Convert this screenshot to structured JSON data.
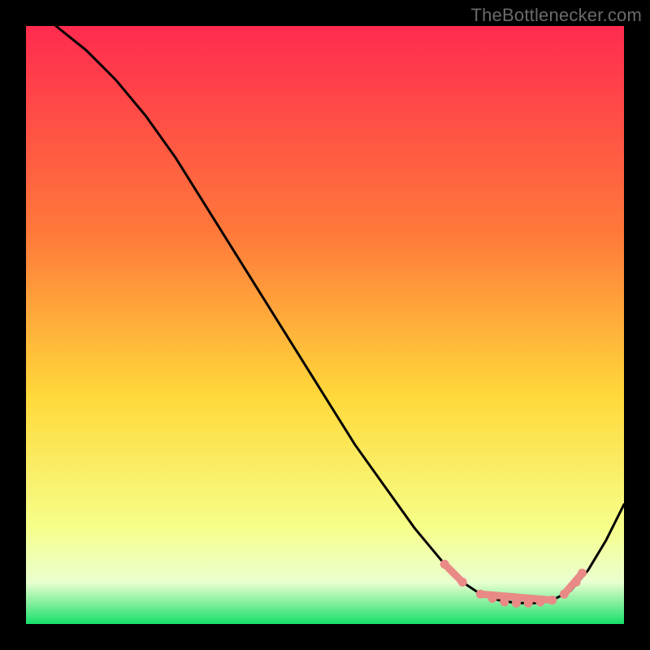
{
  "attribution": "TheBottlenecker.com",
  "colors": {
    "gradient_top": "#ff2b4f",
    "gradient_mid_upper": "#ff7a3a",
    "gradient_mid": "#ffd93a",
    "gradient_low": "#f6ff8a",
    "gradient_band": "#eaffd0",
    "gradient_bottom": "#18e06a",
    "curve": "#000000",
    "markers": "#e98a86"
  },
  "chart_data": {
    "type": "line",
    "title": "",
    "xlabel": "",
    "ylabel": "",
    "xlim": [
      0,
      100
    ],
    "ylim": [
      0,
      100
    ],
    "series": [
      {
        "name": "bottleneck-curve",
        "x": [
          5,
          10,
          15,
          20,
          25,
          30,
          35,
          40,
          45,
          50,
          55,
          60,
          65,
          70,
          73,
          76,
          79,
          82,
          85,
          88,
          91,
          94,
          97,
          100
        ],
        "y": [
          100,
          96,
          91,
          85,
          78,
          70,
          62,
          54,
          46,
          38,
          30,
          23,
          16,
          10,
          7,
          5,
          4,
          3.5,
          3.5,
          4,
          5.5,
          9,
          14,
          20
        ]
      }
    ],
    "markers": {
      "name": "highlighted-range",
      "x_start": 70,
      "x_end": 93,
      "segments": [
        {
          "x1": 70,
          "y1": 10,
          "x2": 73,
          "y2": 7
        },
        {
          "x1": 76,
          "y1": 5,
          "x2": 88,
          "y2": 4
        },
        {
          "x1": 90,
          "y1": 5,
          "x2": 93,
          "y2": 8.5
        }
      ],
      "points": [
        {
          "x": 70,
          "y": 10
        },
        {
          "x": 73,
          "y": 7
        },
        {
          "x": 76,
          "y": 5
        },
        {
          "x": 78,
          "y": 4.3
        },
        {
          "x": 80,
          "y": 3.7
        },
        {
          "x": 82,
          "y": 3.5
        },
        {
          "x": 84,
          "y": 3.5
        },
        {
          "x": 86,
          "y": 3.7
        },
        {
          "x": 88,
          "y": 4
        },
        {
          "x": 90,
          "y": 5
        },
        {
          "x": 92,
          "y": 7
        },
        {
          "x": 93,
          "y": 8.5
        }
      ]
    }
  }
}
